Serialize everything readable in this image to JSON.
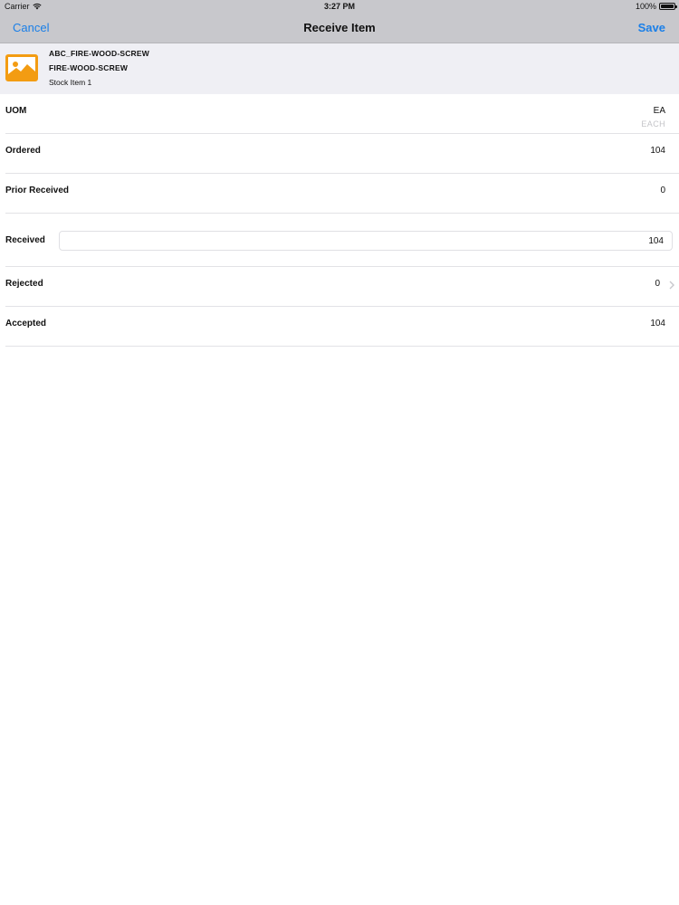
{
  "status_bar": {
    "carrier": "Carrier",
    "time": "3:27 PM",
    "battery": "100%"
  },
  "nav": {
    "cancel_label": "Cancel",
    "title": "Receive Item",
    "save_label": "Save",
    "accent_color": "#1a7fe8"
  },
  "item": {
    "code": "ABC_FIRE-WOOD-SCREW",
    "name": "FIRE-WOOD-SCREW",
    "description": "Stock Item 1",
    "thumbnail_icon": "image-placeholder-icon",
    "thumbnail_color": "#f39c12"
  },
  "fields": {
    "uom": {
      "label": "UOM",
      "value": "EA",
      "sub": "EACH"
    },
    "ordered": {
      "label": "Ordered",
      "value": "104"
    },
    "prior_received": {
      "label": "Prior Received",
      "value": "0"
    },
    "received": {
      "label": "Received",
      "value": "104"
    },
    "rejected": {
      "label": "Rejected",
      "value": "0"
    },
    "accepted": {
      "label": "Accepted",
      "value": "104"
    }
  }
}
